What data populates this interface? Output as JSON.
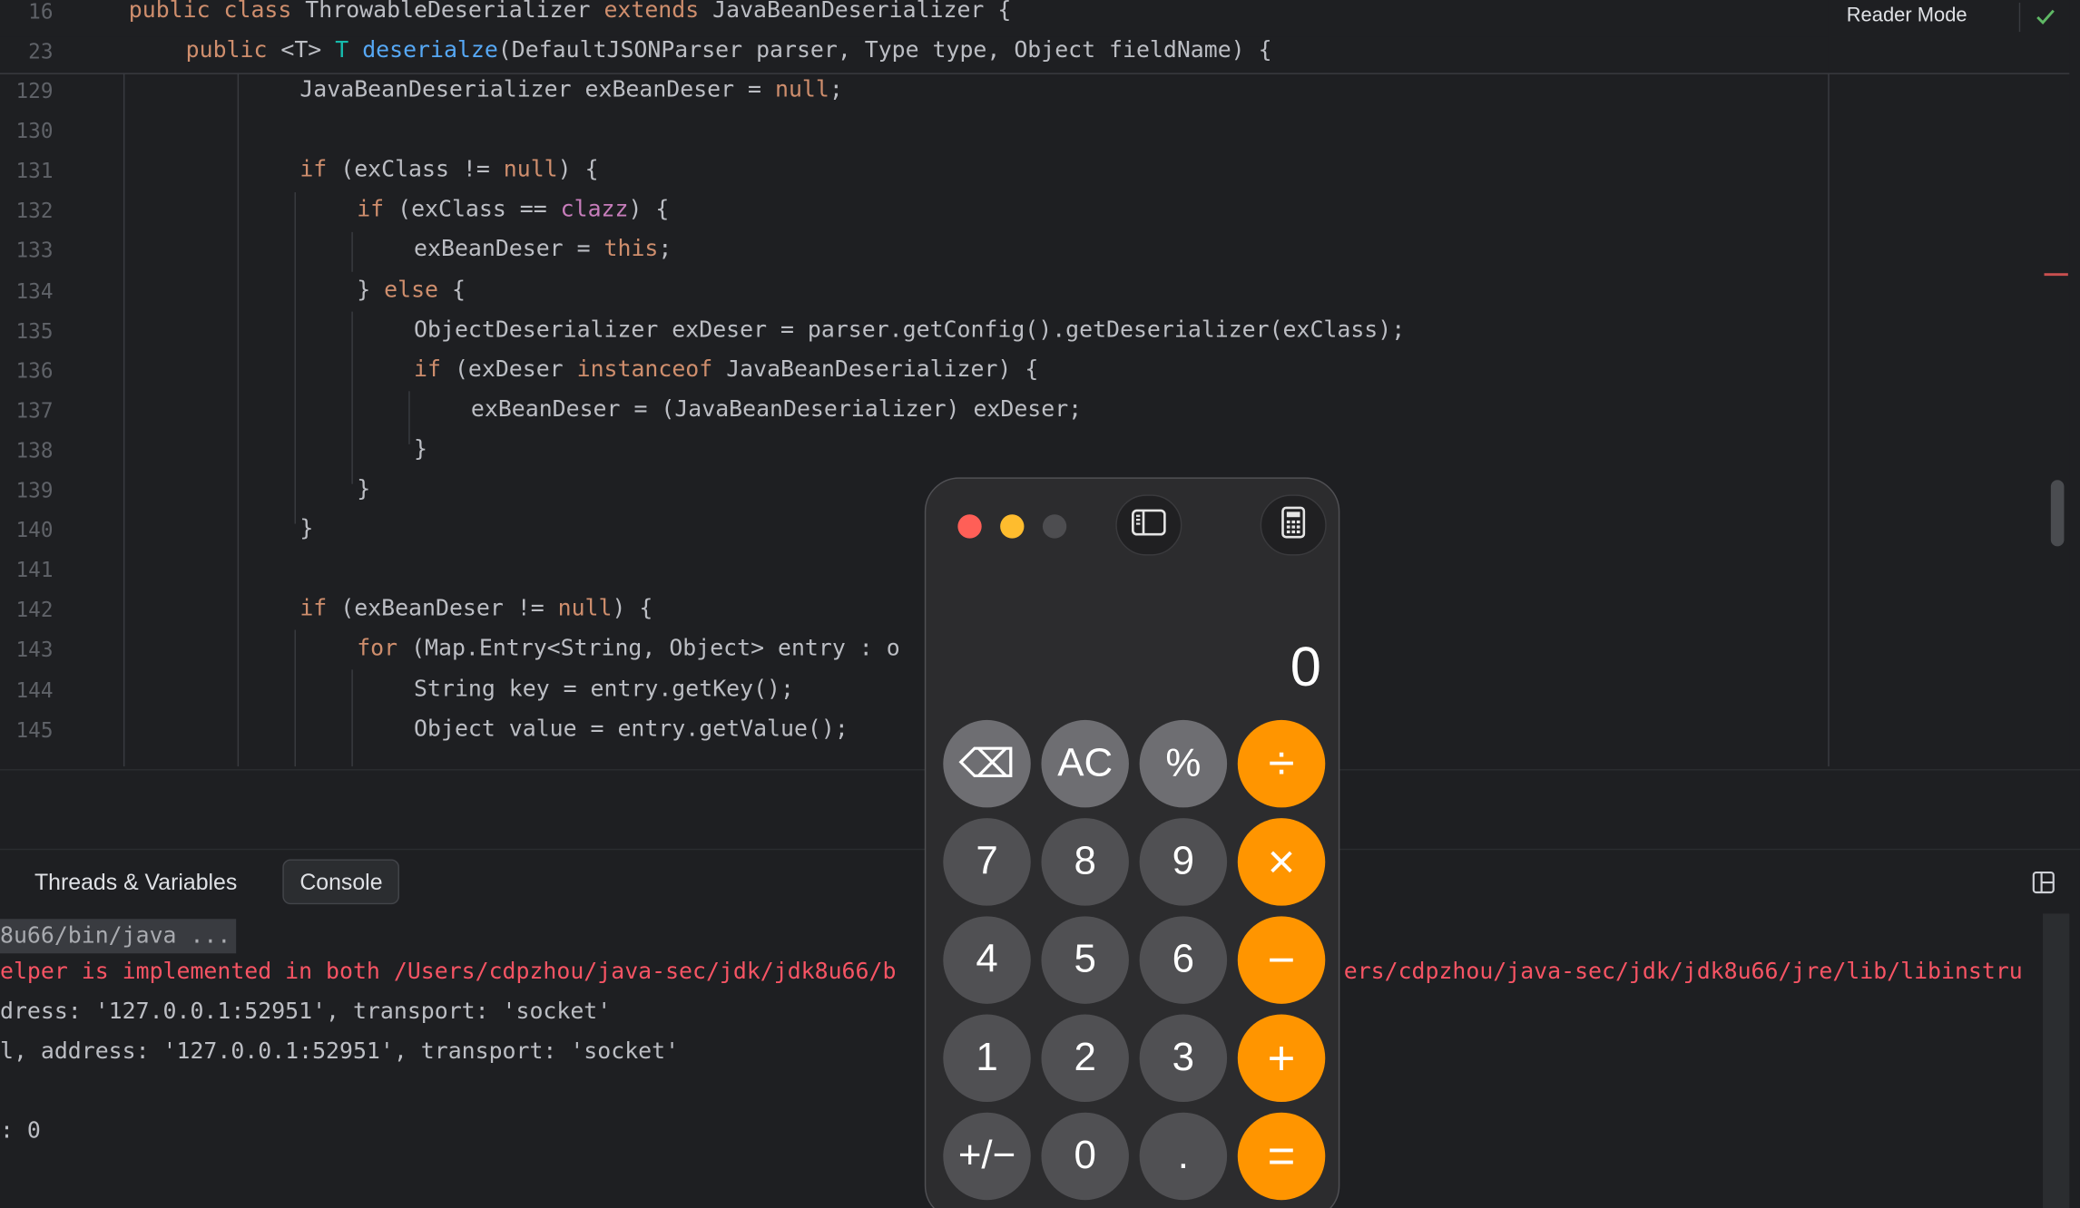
{
  "editor": {
    "sticky": [
      {
        "num": "16",
        "indent": 0,
        "parts": [
          [
            "public ",
            "kw"
          ],
          [
            "class ",
            "kw"
          ],
          [
            "ThrowableDeserializer ",
            ""
          ],
          [
            "extends ",
            "kw"
          ],
          [
            "JavaBeanDeserializer {",
            ""
          ]
        ]
      },
      {
        "num": "23",
        "indent": 1,
        "parts": [
          [
            "public ",
            "kw"
          ],
          [
            "<T> ",
            ""
          ],
          [
            "T ",
            "ty"
          ],
          [
            "deserialze",
            "fn"
          ],
          [
            "(DefaultJSONParser parser, Type type, Object fieldName) {",
            ""
          ]
        ]
      }
    ],
    "lines": [
      {
        "num": "129",
        "indent": 3,
        "parts": [
          [
            "JavaBeanDeserializer exBeanDeser = ",
            ""
          ],
          [
            "null",
            "kw"
          ],
          [
            ";",
            ""
          ]
        ]
      },
      {
        "num": "130",
        "indent": 3,
        "parts": []
      },
      {
        "num": "131",
        "indent": 3,
        "parts": [
          [
            "if ",
            "kw"
          ],
          [
            "(exClass != ",
            ""
          ],
          [
            "null",
            "kw"
          ],
          [
            ") {",
            ""
          ]
        ]
      },
      {
        "num": "132",
        "indent": 4,
        "parts": [
          [
            "if ",
            "kw"
          ],
          [
            "(exClass == ",
            ""
          ],
          [
            "clazz",
            "pur"
          ],
          [
            ") {",
            ""
          ]
        ]
      },
      {
        "num": "133",
        "indent": 5,
        "parts": [
          [
            "exBeanDeser = ",
            ""
          ],
          [
            "this",
            "kw"
          ],
          [
            ";",
            ""
          ]
        ]
      },
      {
        "num": "134",
        "indent": 4,
        "parts": [
          [
            "} ",
            ""
          ],
          [
            "else ",
            "kw"
          ],
          [
            "{",
            ""
          ]
        ]
      },
      {
        "num": "135",
        "indent": 5,
        "parts": [
          [
            "ObjectDeserializer exDeser = parser.getConfig().getDeserializer(exClass);",
            ""
          ]
        ]
      },
      {
        "num": "136",
        "indent": 5,
        "parts": [
          [
            "if ",
            "kw"
          ],
          [
            "(exDeser ",
            ""
          ],
          [
            "instanceof ",
            "kw"
          ],
          [
            "JavaBeanDeserializer) {",
            ""
          ]
        ]
      },
      {
        "num": "137",
        "indent": 6,
        "parts": [
          [
            "exBeanDeser = (JavaBeanDeserializer) exDeser;",
            ""
          ]
        ]
      },
      {
        "num": "138",
        "indent": 5,
        "parts": [
          [
            "}",
            ""
          ]
        ]
      },
      {
        "num": "139",
        "indent": 4,
        "parts": [
          [
            "}",
            ""
          ]
        ]
      },
      {
        "num": "140",
        "indent": 3,
        "parts": [
          [
            "}",
            ""
          ]
        ]
      },
      {
        "num": "141",
        "indent": 3,
        "parts": []
      },
      {
        "num": "142",
        "indent": 3,
        "parts": [
          [
            "if ",
            "kw"
          ],
          [
            "(exBeanDeser != ",
            ""
          ],
          [
            "null",
            "kw"
          ],
          [
            ") {",
            ""
          ]
        ]
      },
      {
        "num": "143",
        "indent": 4,
        "parts": [
          [
            "for ",
            "kw"
          ],
          [
            "(Map.Entry<String, Object> entry : o",
            ""
          ]
        ]
      },
      {
        "num": "144",
        "indent": 5,
        "parts": [
          [
            "String key = entry.getKey();",
            ""
          ]
        ]
      },
      {
        "num": "145",
        "indent": 5,
        "parts": [
          [
            "Object value = entry.getValue();",
            ""
          ]
        ]
      }
    ],
    "reader_mode": "Reader Mode"
  },
  "panel": {
    "tab_threads": "Threads & Variables",
    "tab_console": "Console"
  },
  "console": {
    "cmd": "8u66/bin/java ...",
    "err_left": "elper is implemented in both /Users/cdpzhou/java-sec/jdk/jdk8u66/b",
    "err_right": "ers/cdpzhou/java-sec/jdk/jdk8u66/jre/lib/libinstru",
    "line3": "dress: '127.0.0.1:52951', transport: 'socket'",
    "line4": "l, address: '127.0.0.1:52951', transport: 'socket'",
    "line6": ": 0"
  },
  "calculator": {
    "display": "0",
    "keys": [
      [
        "⌫",
        "AC",
        "%",
        "÷"
      ],
      [
        "7",
        "8",
        "9",
        "×"
      ],
      [
        "4",
        "5",
        "6",
        "−"
      ],
      [
        "1",
        "2",
        "3",
        "+"
      ],
      [
        "+/−",
        "0",
        ".",
        "="
      ]
    ],
    "key_names": [
      [
        "backspace-key",
        "clear-key",
        "percent-key",
        "divide-key"
      ],
      [
        "digit-7-key",
        "digit-8-key",
        "digit-9-key",
        "multiply-key"
      ],
      [
        "digit-4-key",
        "digit-5-key",
        "digit-6-key",
        "subtract-key"
      ],
      [
        "digit-1-key",
        "digit-2-key",
        "digit-3-key",
        "add-key"
      ],
      [
        "negate-key",
        "digit-0-key",
        "decimal-key",
        "equals-key"
      ]
    ]
  },
  "colors": {
    "keyword": "#cf8e6d",
    "function": "#56a8f5",
    "field": "#c77dbb",
    "error_text": "#f75464",
    "operator_key": "#ff9500"
  }
}
